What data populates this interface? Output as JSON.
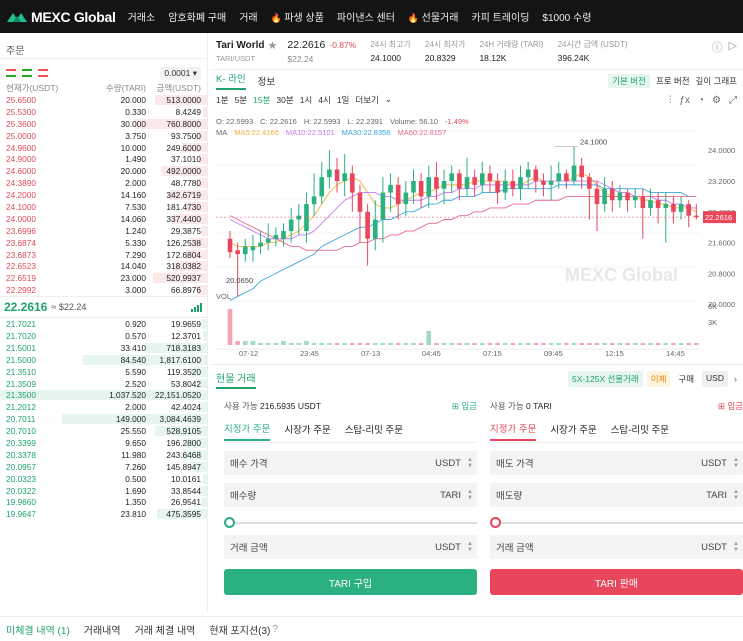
{
  "nav": {
    "logo": "MEXC Global",
    "items": [
      "거래소",
      "암호화폐 구매",
      "거래",
      "파생 상품",
      "파이낸스 센터",
      "선물거래",
      "카피 트레이딩",
      "$1000 수령"
    ],
    "fire_items": [
      3,
      5
    ]
  },
  "orderbook": {
    "title": "주문",
    "precision": "0.0001",
    "headers": [
      "현재가(USDT)",
      "수량(TARI)",
      "금액(USDT)"
    ],
    "asks": [
      [
        "25.6500",
        "20.000",
        "513.0000",
        0.25
      ],
      [
        "25.5300",
        "0.330",
        "8.4249",
        0.02
      ],
      [
        "25.3600",
        "30.000",
        "760.8000",
        0.35
      ],
      [
        "25.0000",
        "3.750",
        "93.7500",
        0.06
      ],
      [
        "24.9600",
        "10.000",
        "249.6000",
        0.12
      ],
      [
        "24.9000",
        "1.490",
        "37.1010",
        0.04
      ],
      [
        "24.6000",
        "20.000",
        "492.0000",
        0.22
      ],
      [
        "24.3890",
        "2.000",
        "48.7780",
        0.05
      ],
      [
        "24.2000",
        "14.160",
        "342.6719",
        0.18
      ],
      [
        "24.1000",
        "7.530",
        "181.4730",
        0.1
      ],
      [
        "24.0000",
        "14.060",
        "337.4400",
        0.17
      ],
      [
        "23.6996",
        "1.240",
        "29.3875",
        0.03
      ],
      [
        "23.6874",
        "5.330",
        "126.2538",
        0.08
      ],
      [
        "23.6873",
        "7.290",
        "172.6804",
        0.1
      ],
      [
        "22.6523",
        "14.040",
        "318.0382",
        0.16
      ],
      [
        "22.6519",
        "23.000",
        "520.9937",
        0.26
      ],
      [
        "22.2992",
        "3.000",
        "66.8976",
        0.05
      ]
    ],
    "last_price": "22.2616",
    "last_price_usd": "≈ $22.24",
    "bids": [
      [
        "21.7021",
        "0.920",
        "19.9659",
        0.03
      ],
      [
        "21.7020",
        "0.570",
        "12.3701",
        0.02
      ],
      [
        "21.5001",
        "33.410",
        "718.3183",
        0.3
      ],
      [
        "21.5000",
        "84.540",
        "1,817.6100",
        0.6
      ],
      [
        "21.3510",
        "5.590",
        "119.3520",
        0.08
      ],
      [
        "21.3509",
        "2.520",
        "53.8042",
        0.05
      ],
      [
        "21.3500",
        "1,037.520",
        "22,151.0520",
        1.0
      ],
      [
        "21.2012",
        "2.000",
        "42.4024",
        0.04
      ],
      [
        "20.7011",
        "149.000",
        "3,084.4639",
        0.7
      ],
      [
        "20.7010",
        "25.550",
        "528.9105",
        0.25
      ],
      [
        "20.3399",
        "9.650",
        "196.2800",
        0.1
      ],
      [
        "20.3378",
        "11.980",
        "243.6468",
        0.12
      ],
      [
        "20.0957",
        "7.260",
        "145.8947",
        0.08
      ],
      [
        "20.0323",
        "0.500",
        "10.0161",
        0.02
      ],
      [
        "20.0322",
        "1.690",
        "33.8544",
        0.04
      ],
      [
        "19.9660",
        "1.350",
        "26.9541",
        0.03
      ],
      [
        "19.9647",
        "23.810",
        "475.3595",
        0.24
      ]
    ]
  },
  "ticker": {
    "name": "Tari World",
    "symbol": "TARI/USDT",
    "price": "22.2616",
    "change": "-0.87%",
    "price_usd": "$22.24",
    "stats": [
      {
        "label": "24시 최고가",
        "value": "24.1000"
      },
      {
        "label": "24시 최저가",
        "value": "20.8329"
      },
      {
        "label": "24H 거래량 (TARI)",
        "value": "18.12K"
      },
      {
        "label": "24시간 금액 (USDT)",
        "value": "396.24K"
      }
    ]
  },
  "chart_tabs": [
    "K- 라인",
    "정보"
  ],
  "view_buttons": [
    "기본 버전",
    "프로 버전",
    "깊이 그래프"
  ],
  "intervals": [
    "1분",
    "5분",
    "15분",
    "30분",
    "1시",
    "4시",
    "1일",
    "더보기"
  ],
  "ohlc_line": {
    "o": "O: 22.5993",
    "c": "C: 22.2616",
    "h": "H: 22.5993",
    "l": "L: 22.2391",
    "vol": "Volume: 56.10",
    "chg": "-1.49%"
  },
  "ma_line": {
    "ma": "MA",
    "ma5": "MA5:22.4166",
    "ma10": "MA10:22.5101",
    "ma30": "MA30:22.8358",
    "ma60": "MA60:22.8157"
  },
  "chart_data": {
    "type": "candlestick",
    "y_ticks": [
      "24.0000",
      "23.2000",
      "22.4000",
      "21.6000",
      "20.8000",
      "20.0000"
    ],
    "y_range": [
      19.9,
      24.5
    ],
    "x_ticks": [
      "07-12",
      "23:45",
      "07-13",
      "04:45",
      "07:15",
      "09:45",
      "12:15",
      "14:45"
    ],
    "vol_ticks": [
      "6K",
      "3K"
    ],
    "vol_label": "VOL",
    "high_label": "24.1000",
    "low_label": "20.0650",
    "current_label": "22.2616",
    "watermark": "MEXC Global",
    "candles": [
      [
        21.7,
        21.35,
        21.9,
        21.2
      ],
      [
        21.4,
        21.3,
        21.6,
        20.2
      ],
      [
        21.3,
        21.5,
        21.7,
        21.1
      ],
      [
        21.4,
        21.5,
        21.8,
        21.1
      ],
      [
        21.5,
        21.6,
        21.9,
        21.3
      ],
      [
        21.6,
        21.7,
        22.1,
        21.4
      ],
      [
        21.7,
        21.8,
        22.0,
        21.5
      ],
      [
        21.7,
        21.9,
        22.1,
        21.5
      ],
      [
        21.9,
        22.2,
        22.5,
        21.6
      ],
      [
        22.2,
        22.3,
        22.6,
        21.8
      ],
      [
        21.9,
        22.6,
        22.9,
        21.6
      ],
      [
        22.6,
        22.8,
        23.4,
        22.3
      ],
      [
        22.8,
        23.3,
        23.7,
        22.6
      ],
      [
        23.3,
        23.5,
        24.0,
        23.0
      ],
      [
        23.5,
        23.2,
        23.8,
        22.9
      ],
      [
        23.2,
        23.4,
        23.9,
        22.8
      ],
      [
        23.4,
        22.9,
        23.6,
        22.4
      ],
      [
        22.9,
        22.4,
        23.1,
        21.6
      ],
      [
        22.4,
        21.7,
        22.6,
        21.0
      ],
      [
        21.7,
        22.2,
        22.7,
        21.4
      ],
      [
        22.2,
        22.9,
        23.3,
        21.6
      ],
      [
        22.9,
        23.1,
        23.4,
        22.4
      ],
      [
        23.1,
        22.6,
        23.3,
        22.2
      ],
      [
        22.6,
        22.9,
        23.2,
        22.3
      ],
      [
        22.9,
        23.2,
        23.5,
        22.6
      ],
      [
        23.2,
        22.8,
        23.4,
        22.5
      ],
      [
        22.8,
        23.3,
        23.6,
        22.5
      ],
      [
        23.3,
        23.0,
        23.7,
        22.7
      ],
      [
        23.0,
        23.2,
        23.5,
        22.6
      ],
      [
        23.2,
        23.4,
        23.6,
        22.9
      ],
      [
        23.4,
        23.0,
        23.5,
        22.7
      ],
      [
        23.0,
        23.3,
        23.8,
        22.8
      ],
      [
        23.3,
        23.1,
        23.5,
        22.8
      ],
      [
        23.1,
        23.4,
        23.7,
        22.9
      ],
      [
        23.4,
        23.2,
        23.6,
        22.9
      ],
      [
        23.2,
        22.9,
        23.4,
        22.6
      ],
      [
        22.9,
        23.2,
        23.5,
        22.7
      ],
      [
        23.2,
        23.0,
        23.5,
        22.8
      ],
      [
        23.0,
        23.3,
        23.6,
        22.7
      ],
      [
        23.3,
        23.5,
        23.7,
        23.0
      ],
      [
        23.5,
        23.2,
        23.6,
        22.9
      ],
      [
        23.2,
        23.1,
        23.4,
        22.8
      ],
      [
        23.1,
        23.2,
        23.6,
        22.7
      ],
      [
        23.2,
        23.4,
        23.7,
        23.0
      ],
      [
        23.4,
        23.2,
        23.5,
        23.0
      ],
      [
        23.2,
        23.6,
        24.1,
        23.1
      ],
      [
        23.6,
        23.3,
        23.8,
        23.0
      ],
      [
        23.3,
        23.0,
        23.4,
        22.2
      ],
      [
        23.0,
        22.6,
        23.2,
        21.9
      ],
      [
        22.6,
        23.0,
        23.3,
        22.4
      ],
      [
        23.0,
        22.7,
        23.2,
        22.4
      ],
      [
        22.7,
        22.9,
        23.1,
        22.5
      ],
      [
        22.9,
        22.7,
        23.0,
        22.4
      ],
      [
        22.7,
        22.8,
        23.0,
        22.5
      ],
      [
        22.8,
        22.5,
        23.0,
        21.7
      ],
      [
        22.5,
        22.7,
        23.0,
        22.3
      ],
      [
        22.7,
        22.5,
        22.9,
        22.1
      ],
      [
        22.5,
        22.6,
        22.9,
        21.6
      ],
      [
        22.6,
        22.4,
        22.8,
        22.1
      ],
      [
        22.4,
        22.6,
        22.8,
        22.2
      ],
      [
        22.6,
        22.3,
        22.7,
        22.0
      ],
      [
        22.3,
        22.26,
        22.6,
        22.2
      ]
    ],
    "volumes": [
      0.9,
      0.1,
      0.1,
      0.1,
      0.05,
      0.05,
      0.05,
      0.1,
      0.05,
      0.05,
      0.1,
      0.05,
      0.05,
      0.05,
      0.05,
      0.05,
      0.05,
      0.05,
      0.05,
      0.05,
      0.05,
      0.05,
      0.05,
      0.05,
      0.05,
      0.05,
      0.35,
      0.05,
      0.05,
      0.05,
      0.05,
      0.05,
      0.05,
      0.05,
      0.05,
      0.05,
      0.05,
      0.05,
      0.05,
      0.05,
      0.05,
      0.05,
      0.05,
      0.05,
      0.05,
      0.05,
      0.05,
      0.05,
      0.05,
      0.05,
      0.05,
      0.05,
      0.05,
      0.05,
      0.05,
      0.05,
      0.05,
      0.05,
      0.05,
      0.05,
      0.05,
      0.05
    ],
    "ma_lines": [
      {
        "name": "MA5",
        "color": "#f5b041",
        "values": [
          21.6,
          21.5,
          21.5,
          21.5,
          21.5,
          21.6,
          21.6,
          21.7,
          21.8,
          21.9,
          22.1,
          22.3,
          22.6,
          22.9,
          23.1,
          23.2,
          23.3,
          23.2,
          22.9,
          22.6,
          22.5,
          22.5,
          22.6,
          22.7,
          22.8,
          22.9,
          22.9,
          23.0,
          23.1,
          23.1,
          23.1,
          23.1,
          23.2,
          23.2,
          23.2,
          23.2,
          23.2,
          23.1,
          23.1,
          23.2,
          23.3,
          23.2,
          23.2,
          23.2,
          23.2,
          23.3,
          23.4,
          23.3,
          23.1,
          22.9,
          22.8,
          22.8,
          22.8,
          22.8,
          22.7,
          22.7,
          22.6,
          22.6,
          22.5,
          22.5,
          22.5,
          22.4
        ]
      },
      {
        "name": "MA10",
        "color": "#c879f0",
        "values": [
          22.2,
          22.1,
          22.0,
          21.9,
          21.8,
          21.7,
          21.7,
          21.7,
          21.7,
          21.8,
          21.8,
          21.9,
          22.1,
          22.3,
          22.5,
          22.7,
          22.8,
          22.9,
          22.9,
          22.9,
          22.8,
          22.8,
          22.7,
          22.7,
          22.7,
          22.7,
          22.8,
          22.8,
          22.9,
          22.9,
          23.0,
          23.0,
          23.0,
          23.1,
          23.1,
          23.1,
          23.1,
          23.1,
          23.1,
          23.1,
          23.2,
          23.2,
          23.2,
          23.2,
          23.2,
          23.2,
          23.2,
          23.2,
          23.2,
          23.1,
          23.0,
          22.9,
          22.9,
          22.8,
          22.8,
          22.8,
          22.7,
          22.7,
          22.6,
          22.6,
          22.5,
          22.5
        ]
      },
      {
        "name": "MA30",
        "color": "#3aa6e0",
        "values": [
          20.1,
          20.2,
          20.3,
          20.4,
          20.6,
          20.7,
          20.8,
          20.9,
          21.0,
          21.1,
          21.2,
          21.3,
          21.5,
          21.6,
          21.7,
          21.8,
          21.9,
          22.0,
          22.0,
          22.1,
          22.2,
          22.2,
          22.3,
          22.4,
          22.4,
          22.5,
          22.6,
          22.6,
          22.7,
          22.7,
          22.8,
          22.8,
          22.8,
          22.9,
          22.9,
          22.9,
          23.0,
          23.0,
          23.0,
          23.0,
          23.0,
          23.0,
          23.0,
          23.1,
          23.1,
          23.1,
          23.1,
          23.1,
          23.1,
          23.0,
          23.0,
          23.0,
          23.0,
          23.0,
          23.0,
          22.9,
          22.9,
          22.9,
          22.9,
          22.9,
          22.8,
          22.8
        ]
      },
      {
        "name": "MA60",
        "color": "#e86a8a",
        "values": [
          22.3,
          22.2,
          22.1,
          22.0,
          21.9,
          21.8,
          21.7,
          21.6,
          21.5,
          21.5,
          21.4,
          21.4,
          21.4,
          21.4,
          21.4,
          21.5,
          21.5,
          21.6,
          21.6,
          21.7,
          21.7,
          21.8,
          21.8,
          21.9,
          21.9,
          22.0,
          22.1,
          22.1,
          22.2,
          22.2,
          22.3,
          22.3,
          22.4,
          22.4,
          22.5,
          22.5,
          22.5,
          22.6,
          22.6,
          22.6,
          22.7,
          22.7,
          22.7,
          22.7,
          22.8,
          22.8,
          22.8,
          22.8,
          22.8,
          22.8,
          22.8,
          22.8,
          22.8,
          22.8,
          22.8,
          22.8,
          22.8,
          22.8,
          22.8,
          22.8,
          22.8,
          22.8
        ]
      }
    ]
  },
  "trade": {
    "title": "현물 거래",
    "pills": [
      {
        "label": "5X-125X 선물거래",
        "bg": "#e6f6ee",
        "fg": "#1fa36a"
      },
      {
        "label": "이체",
        "bg": "#fff4e0",
        "fg": "#e08a00"
      },
      {
        "label": "구매",
        "bg": "#fff",
        "fg": "#333"
      },
      {
        "label": "USD",
        "bg": "#f0f0f0",
        "fg": "#333"
      }
    ],
    "buy": {
      "avail_label": "사용 가능",
      "avail_value": "216.5935 USDT",
      "deposit": "입금",
      "tabs": [
        "지정가 주문",
        "시장가 주문",
        "스탑-리밋 주문"
      ],
      "price_label": "매수 가격",
      "price_unit": "USDT",
      "qty_label": "매수량",
      "qty_unit": "TARI",
      "amount_label": "거래 금액",
      "amount_unit": "USDT",
      "button": "TARI 구입",
      "color": "#2bb07f"
    },
    "sell": {
      "avail_label": "사용 가능",
      "avail_value": "0 TARI",
      "deposit": "입금",
      "tabs": [
        "지정가 주문",
        "시장가 주문",
        "스탑-리밋 주문"
      ],
      "price_label": "매도 가격",
      "price_unit": "USDT",
      "qty_label": "매도량",
      "qty_unit": "TARI",
      "amount_label": "거래 금액",
      "amount_unit": "USDT",
      "button": "TARI 판매",
      "color": "#e8465a"
    }
  },
  "bottom_tabs": [
    "미체결 내역 (1)",
    "거래내역",
    "거래 체결 내역",
    "현재 포지션(3)"
  ]
}
